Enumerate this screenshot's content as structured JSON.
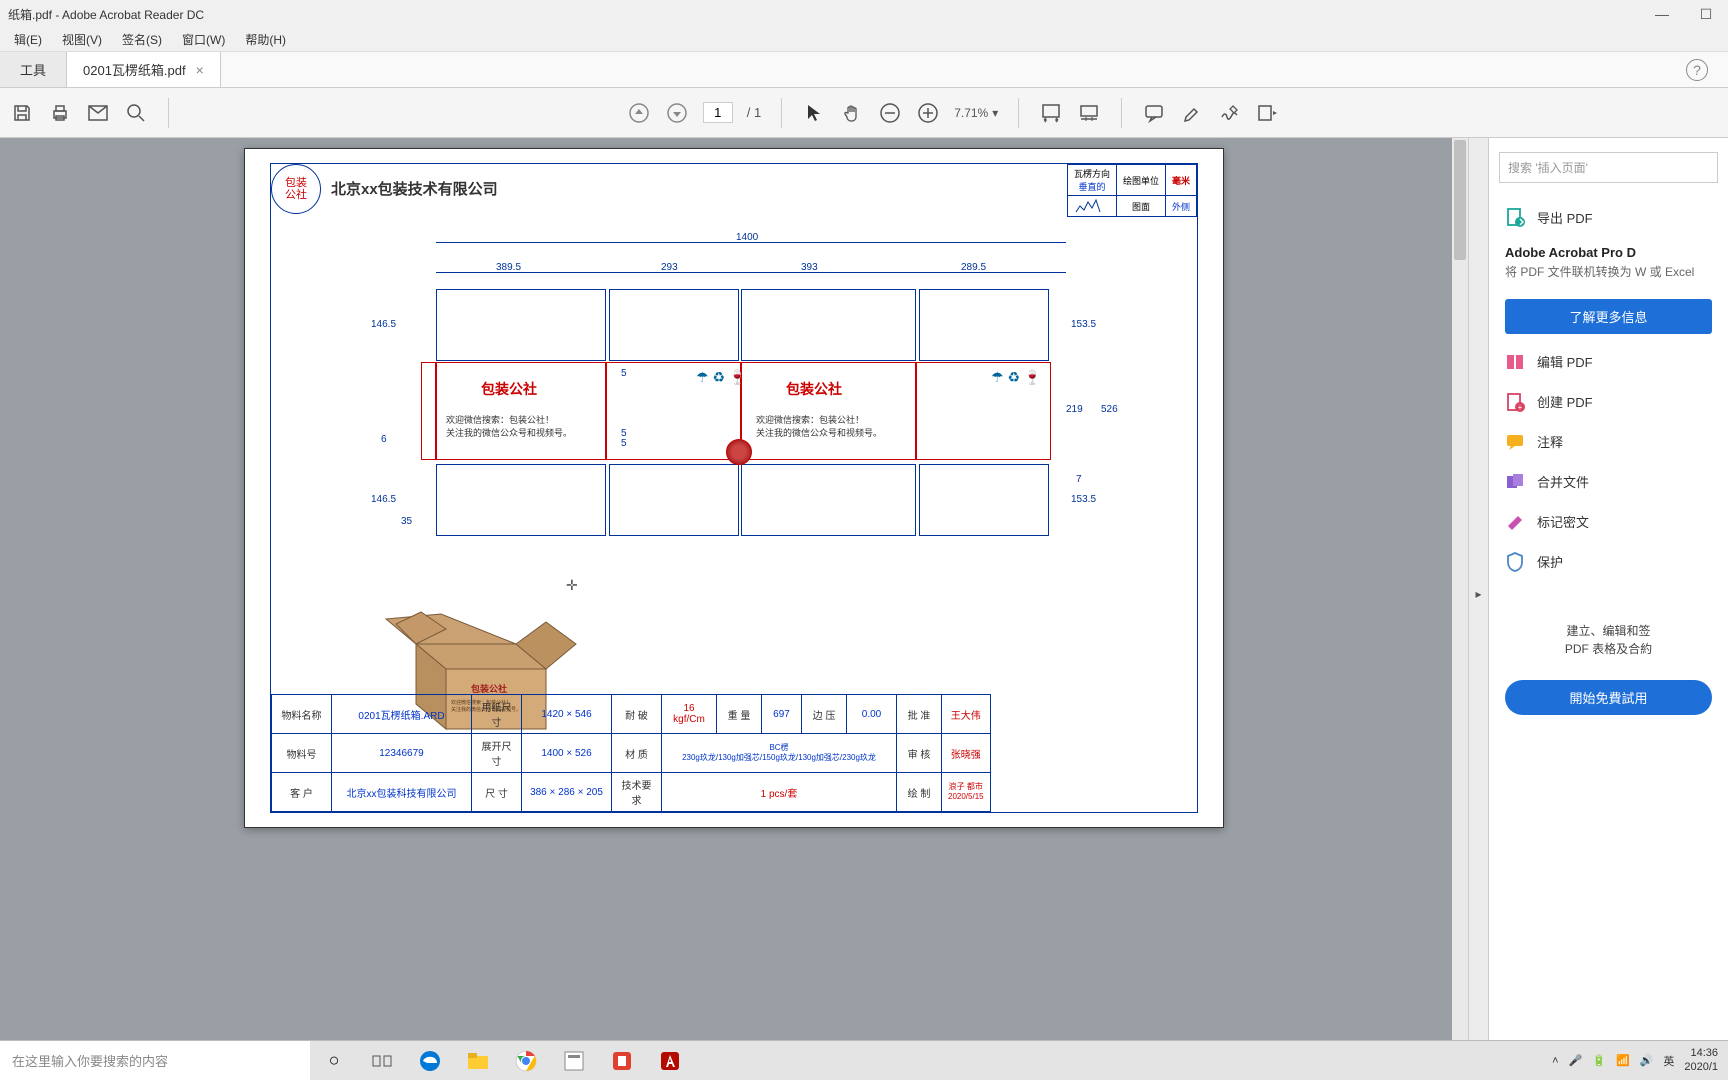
{
  "window": {
    "title": "纸箱.pdf - Adobe Acrobat Reader DC"
  },
  "menu": {
    "edit": "辑(E)",
    "view": "视图(V)",
    "sign": "签名(S)",
    "window": "窗口(W)",
    "help": "帮助(H)"
  },
  "tabs": {
    "tools": "工具",
    "file": "0201瓦楞纸箱.pdf"
  },
  "toolbar": {
    "page_current": "1",
    "page_total": "/ 1",
    "zoom": "7.71%"
  },
  "doc": {
    "logo": "包装\n公社",
    "company": "北京xx包装技术有限公司",
    "info": {
      "r1c1": "瓦楞方向",
      "r1c1v": "垂直的",
      "r1c2": "绘图单位",
      "r1c3": "毫米",
      "r2c1_icon": "hatching",
      "r2c2": "图面",
      "r2c3": "外侧"
    },
    "dims": {
      "top_total": "1400",
      "p1": "389.5",
      "p2": "293",
      "p3": "393",
      "p4": "289.5",
      "h_top": "146.5",
      "h_right_top": "153.5",
      "h_mid_left": "6",
      "h_mid_r1": "219",
      "h_mid_r2": "526",
      "h_bot": "146.5",
      "h_bot2": "35",
      "h_right_bot": "153.5",
      "h_right_bot_7": "7",
      "slit5a": "5",
      "slit5b": "5",
      "slit5c": "5"
    },
    "panel_brand": "包装公社",
    "panel_msg1": "欢迎微信搜索：包装公社！",
    "panel_msg2": "关注我的微信公众号和视频号。",
    "table": {
      "r1": {
        "c1": "物料名称",
        "c2": "0201瓦楞纸箱.ARD",
        "c3": "用纸尺寸",
        "c4": "1420 × 546",
        "c5": "耐    破",
        "c6": "16 kgf/Cm",
        "c7": "重    量",
        "c8": "697",
        "c9": "边    压",
        "c10": "0.00",
        "c11": "批    准",
        "c12": "王大伟"
      },
      "r2": {
        "c1": "物料号",
        "c2": "12346679",
        "c3": "展开尺寸",
        "c4": "1400 × 526",
        "c5": "材    质",
        "c6": "BC楞\n230g玖龙/130g加强芯/150g玖龙/130g加强芯/230g玖龙",
        "c7": "审    核",
        "c8": "张晓强"
      },
      "r3": {
        "c1": "客    户",
        "c2": "北京xx包装科技有限公司",
        "c3": "尺    寸",
        "c4": "386 × 286 × 205",
        "c5": "技术要求",
        "c6": "1 pcs/套",
        "c7": "绘    制",
        "c8": "浪子 都市\n2020/5/15"
      }
    }
  },
  "sidebar": {
    "search_placeholder": "搜索 '插入页面'",
    "export": "导出 PDF",
    "pro_title": "Adobe Acrobat Pro D",
    "pro_sub": "将 PDF 文件联机转换为 W 或 Excel",
    "learn_more": "了解更多信息",
    "edit": "编辑 PDF",
    "create": "创建 PDF",
    "comment": "注释",
    "combine": "合并文件",
    "redact": "标记密文",
    "protect": "保护",
    "promo": "建立、编辑和签\nPDF 表格及合約",
    "try_free": "開始免費試用"
  },
  "taskbar": {
    "search": "在这里输入你要搜索的内容",
    "ime": "英",
    "time": "14:36",
    "date": "2020/1"
  }
}
